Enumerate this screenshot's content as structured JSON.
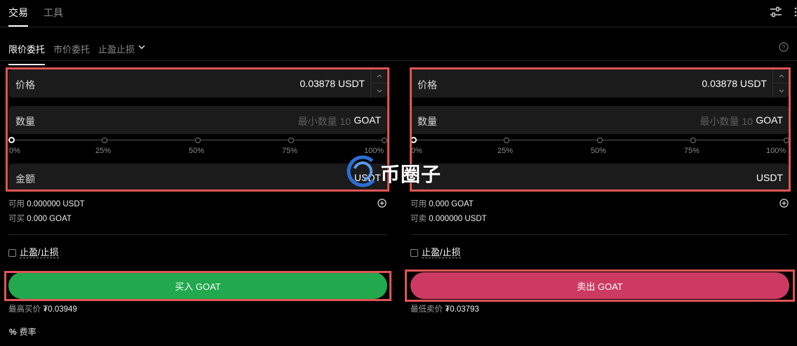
{
  "topnav": {
    "tabs": [
      {
        "label": "交易",
        "active": true
      },
      {
        "label": "工具",
        "active": false
      }
    ],
    "tune_icon": "sliders-icon",
    "more_icon": "more-icon"
  },
  "order_tabs": {
    "items": [
      {
        "label": "限价委托",
        "active": true
      },
      {
        "label": "市价委托",
        "active": false
      },
      {
        "label": "止盈止损",
        "active": false,
        "dropdown": true
      }
    ],
    "help_icon": "help-circle-icon"
  },
  "buy": {
    "price_label": "价格",
    "price_value": "0.03878",
    "price_unit": "USDT",
    "qty_label": "数量",
    "qty_placeholder": "最小数量 10",
    "qty_unit": "GOAT",
    "slider_labels": [
      "0%",
      "25%",
      "50%",
      "75%",
      "100%"
    ],
    "slider_percent": 0,
    "amount_label": "金额",
    "amount_unit": "USDT",
    "available_label": "可用",
    "available_value": "0.000000 USDT",
    "can_label": "可买",
    "can_value": "0.000 GOAT",
    "tpsl_label": "止盈/止损",
    "button_label": "买入 GOAT",
    "best_label": "最高买价",
    "best_value": "₮0.03949"
  },
  "sell": {
    "price_label": "价格",
    "price_value": "0.03878",
    "price_unit": "USDT",
    "qty_label": "数量",
    "qty_placeholder": "最小数量 10",
    "qty_unit": "GOAT",
    "slider_labels": [
      "0%",
      "25%",
      "50%",
      "75%",
      "100%"
    ],
    "slider_percent": 0,
    "amount_unit": "USDT",
    "available_label": "可用",
    "available_value": "0.000 GOAT",
    "can_label": "可卖",
    "can_value": "0.000000 USDT",
    "tpsl_label": "止盈/止损",
    "button_label": "卖出 GOAT",
    "best_label": "最低卖价",
    "best_value": "₮0.03793"
  },
  "fee": {
    "icon": "%",
    "label": "费率"
  },
  "watermark": {
    "text": "币圈子"
  },
  "colors": {
    "buy": "#22a84d",
    "sell": "#cc3a62",
    "highlight": "#e05555"
  }
}
